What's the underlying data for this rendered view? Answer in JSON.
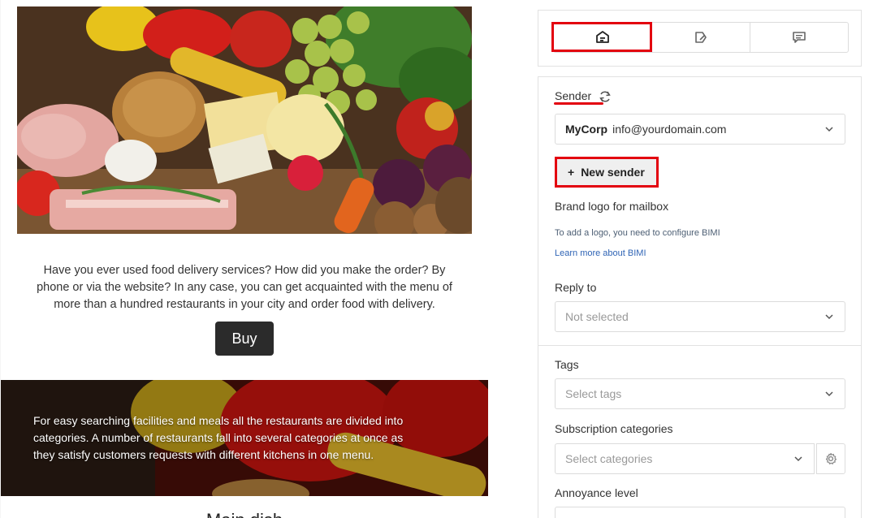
{
  "email": {
    "intro_text": "Have you ever used food delivery services? How did you make the order? By phone or via the website? In any case, you can get acquainted with the menu of more than a hundred restaurants in your city and order food with delivery.",
    "buy_label": "Buy",
    "banner_text": "For easy searching facilities and meals all the restaurants are divided into categories. A number of restaurants fall into several categories at once as they satisfy customers requests with different kitchens in one menu.",
    "next_heading_partial": "Main dish"
  },
  "tabs": [
    {
      "icon": "envelope-sender-icon",
      "active": true
    },
    {
      "icon": "tag-edit-icon",
      "active": false
    },
    {
      "icon": "message-icon",
      "active": false
    }
  ],
  "settings": {
    "sender_label": "Sender",
    "sender_name": "MyCorp",
    "sender_email": "info@yourdomain.com",
    "new_sender_label": "New sender",
    "brand_logo_label": "Brand logo for mailbox",
    "bimi_note": "To add a logo, you need to configure BIMI",
    "bimi_link": "Learn more about BIMI",
    "reply_to_label": "Reply to",
    "reply_to_value": "Not selected",
    "tags_label": "Tags",
    "tags_placeholder": "Select tags",
    "subscription_label": "Subscription categories",
    "subscription_placeholder": "Select categories",
    "annoyance_label": "Annoyance level"
  },
  "colors": {
    "highlight": "#e3000f",
    "link": "#2f64b5",
    "button_dark": "#2b2b2b"
  }
}
